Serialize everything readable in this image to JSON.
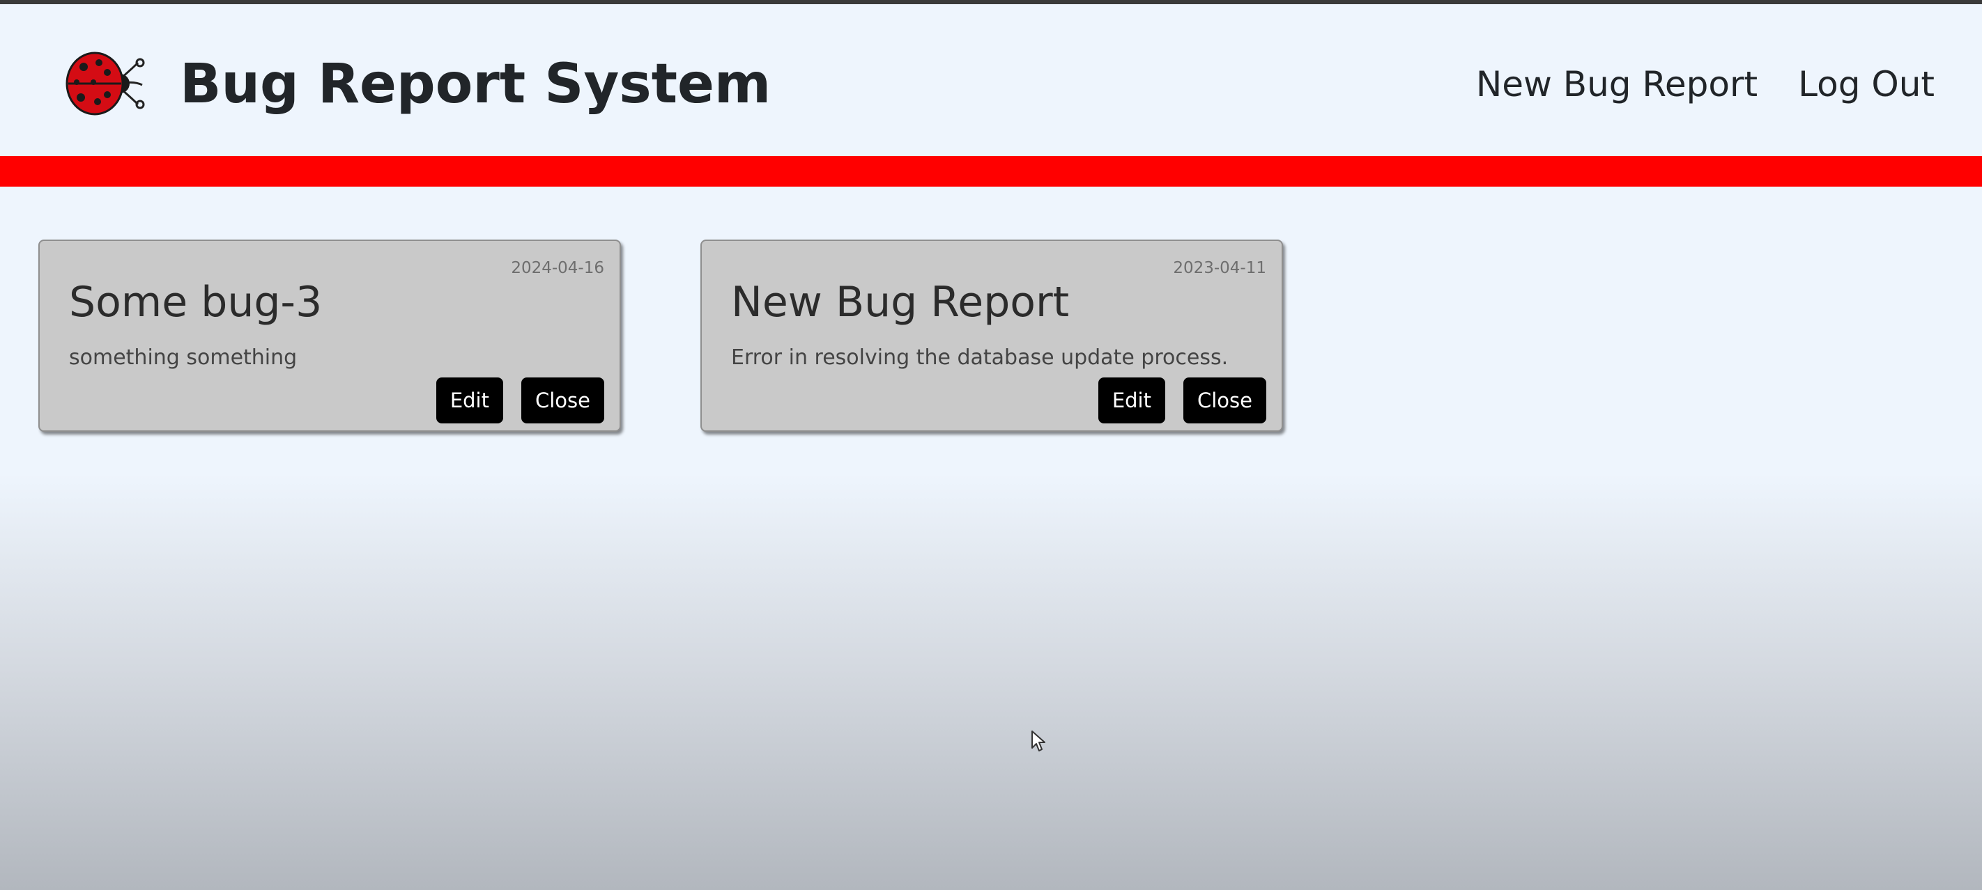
{
  "header": {
    "title": "Bug Report System",
    "logo_icon": "ladybug-icon",
    "nav": {
      "new_bug_report": "New Bug Report",
      "log_out": "Log Out"
    }
  },
  "colors": {
    "accent_bar": "#ff0000",
    "card_background": "#c9c9c9",
    "button_background": "#000000",
    "button_text": "#ffffff"
  },
  "bugs": [
    {
      "date": "2024-04-16",
      "title": "Some bug-3",
      "description": "something something",
      "edit_label": "Edit",
      "close_label": "Close"
    },
    {
      "date": "2023-04-11",
      "title": "New Bug Report",
      "description": "Error in resolving the database update process.",
      "edit_label": "Edit",
      "close_label": "Close"
    }
  ]
}
